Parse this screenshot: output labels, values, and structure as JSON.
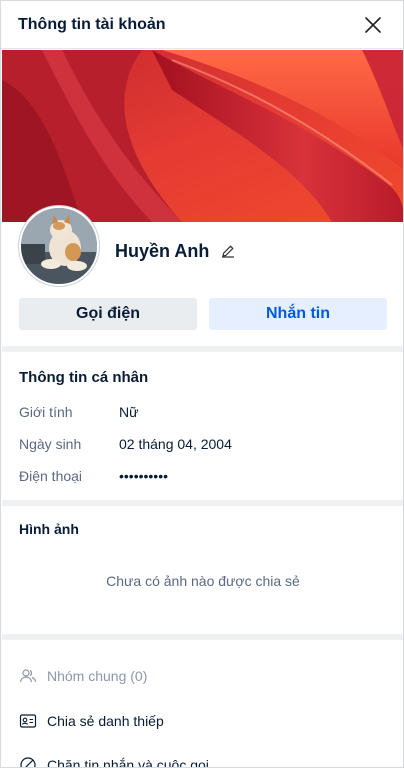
{
  "header": {
    "title": "Thông tin tài khoản"
  },
  "profile": {
    "name": "Huyền Anh"
  },
  "actions": {
    "call_label": "Gọi điện",
    "message_label": "Nhắn tin"
  },
  "personal_info": {
    "title": "Thông tin cá nhân",
    "rows": [
      {
        "label": "Giới tính",
        "value": "Nữ"
      },
      {
        "label": "Ngày sinh",
        "value": "02 tháng 04, 2004"
      },
      {
        "label": "Điện thoại",
        "value": "••••••••••"
      }
    ]
  },
  "photos": {
    "title": "Hình ảnh",
    "empty_text": "Chưa có ảnh nào được chia sẻ"
  },
  "menu": {
    "items": [
      {
        "label": "Nhóm chung (0)",
        "icon": "group-icon"
      },
      {
        "label": "Chia sẻ danh thiếp",
        "icon": "contact-card-icon"
      },
      {
        "label": "Chặn tin nhắn và cuộc gọi",
        "icon": "block-icon"
      }
    ]
  },
  "colors": {
    "primary": "#005ae0",
    "message_bg": "#e5efff",
    "call_bg": "#eaedf0",
    "text": "#081c36",
    "muted": "#5a6981"
  }
}
